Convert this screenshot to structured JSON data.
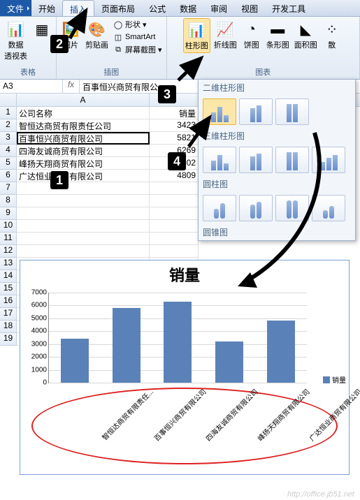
{
  "tabs": {
    "file": "文件",
    "home": "开始",
    "insert": "插入",
    "layout": "页面布局",
    "formula": "公式",
    "data": "数据",
    "review": "审阅",
    "view": "视图",
    "dev": "开发工具"
  },
  "ribbon": {
    "group_tables": "表格",
    "pivot": "数据\n透视表",
    "table": "表格",
    "group_illus": "插图",
    "picture": "图片",
    "clipart": "剪贴画",
    "shapes": "形状",
    "smartart": "SmartArt",
    "screenshot": "屏幕截图",
    "group_charts": "图表",
    "column": "柱形图",
    "line": "折线图",
    "pie": "饼图",
    "bar": "条形图",
    "area": "面积图",
    "scatter": "散"
  },
  "namebox": "A3",
  "fx": "fx",
  "formula_value": "百事恒兴商贸有限公",
  "headers": {
    "A": "A",
    "B": "B"
  },
  "rows": [
    {
      "n": "1",
      "a": "公司名称",
      "b": "销量"
    },
    {
      "n": "2",
      "a": "智恒达商贸有限责任公司",
      "b": "3423"
    },
    {
      "n": "3",
      "a": "百事恒兴商贸有限公司",
      "b": "5821"
    },
    {
      "n": "4",
      "a": "四海友诚商贸有限公司",
      "b": "6269"
    },
    {
      "n": "5",
      "a": "峰扬天翔商贸有限公司",
      "b": "3202"
    },
    {
      "n": "6",
      "a": "广达恒业商贸有限公司",
      "b": "4809"
    },
    {
      "n": "7",
      "a": "",
      "b": ""
    },
    {
      "n": "8",
      "a": "",
      "b": ""
    },
    {
      "n": "9",
      "a": "",
      "b": ""
    },
    {
      "n": "10",
      "a": "",
      "b": ""
    },
    {
      "n": "11",
      "a": "",
      "b": ""
    },
    {
      "n": "12",
      "a": "",
      "b": ""
    },
    {
      "n": "13",
      "a": "",
      "b": ""
    },
    {
      "n": "14",
      "a": "",
      "b": ""
    },
    {
      "n": "15",
      "a": "",
      "b": ""
    },
    {
      "n": "16",
      "a": "",
      "b": ""
    },
    {
      "n": "17",
      "a": "",
      "b": ""
    },
    {
      "n": "18",
      "a": "",
      "b": ""
    },
    {
      "n": "19",
      "a": "",
      "b": ""
    }
  ],
  "panel": {
    "sec_2d": "二维柱形图",
    "sec_3d": "三维柱形图",
    "sec_cyl": "圆柱图",
    "sec_cone": "圆锥图"
  },
  "chart_data": {
    "type": "bar",
    "title": "销量",
    "categories": [
      "智恒达商贸有限责任...",
      "百事恒兴商贸有限公司",
      "四海友诚商贸有限公司",
      "峰扬天翔商贸有限公司",
      "广达恒业商贸有限公司"
    ],
    "values": [
      3423,
      5821,
      6269,
      3202,
      4809
    ],
    "series_name": "销量",
    "ylim": [
      0,
      7000
    ],
    "yticks": [
      0,
      1000,
      2000,
      3000,
      4000,
      5000,
      6000,
      7000
    ],
    "xlabel": "",
    "ylabel": ""
  },
  "callouts": {
    "c1": "1",
    "c2": "2",
    "c3": "3",
    "c4": "4"
  },
  "watermark": "http://office.jb51.net"
}
